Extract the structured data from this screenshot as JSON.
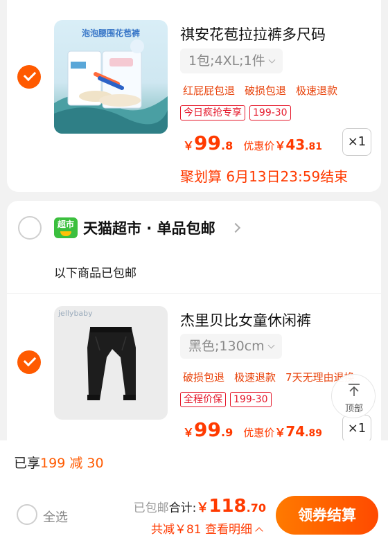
{
  "colors": {
    "accent": "#ff5a00",
    "price": "#ff3a00",
    "tag_red": "#e5172a"
  },
  "items": [
    {
      "title": "祺安花苞拉拉裤多尺码",
      "spec": "1包;4XL;1件",
      "services": [
        "红屁屁包退",
        "破损包退",
        "极速退款"
      ],
      "tags": [
        "今日疯抢专享",
        "199-30"
      ],
      "price_yen": "￥",
      "price_int": "99",
      "price_dec": ".8",
      "discount_label": "优惠价",
      "discount_yen": "￥",
      "discount_int": "43",
      "discount_dec": ".81",
      "qty": "×1",
      "promo_end": "聚划算 6月13日23:59结束",
      "image_text": "泡泡腰围花苞裤",
      "checked": true
    },
    {
      "title": "杰里贝比女童休闲裤",
      "spec": "黑色;130cm",
      "services": [
        "破损包退",
        "极速退款",
        "7天无理由退换"
      ],
      "tags": [
        "全程价保",
        "199-30"
      ],
      "price_yen": "￥",
      "price_int": "99",
      "price_dec": ".9",
      "discount_label": "优惠价",
      "discount_yen": "￥",
      "discount_int": "74",
      "discount_dec": ".89",
      "qty": "×1",
      "image_text": "jellybaby",
      "checked": true
    }
  ],
  "shop": {
    "logo_text": "超市",
    "name": "天猫超市 · 单品包邮",
    "free_shipping_note": "以下商品已包邮"
  },
  "back_to_top": "顶部",
  "bottom_bar": {
    "saving_prefix": "已享",
    "saving_value": "199 减 30",
    "select_all": "全选",
    "shipping": "已包邮",
    "total_label": "合计:",
    "total_yen": "￥",
    "total_int": "118",
    "total_dec": ".70",
    "reduce_text": "共减￥81 查看明细",
    "checkout": "领券结算"
  }
}
